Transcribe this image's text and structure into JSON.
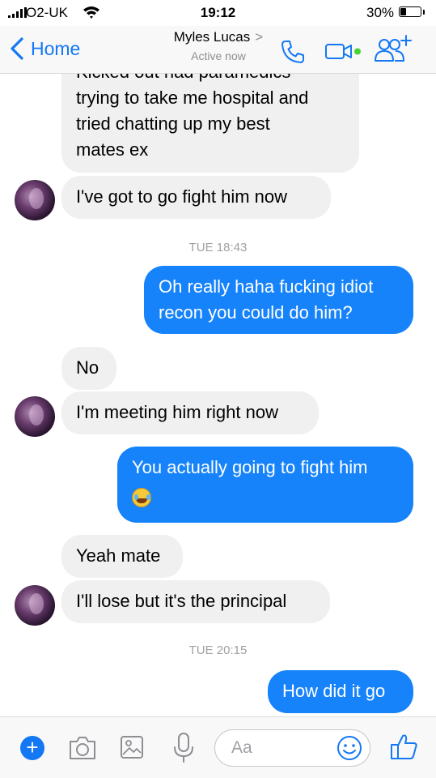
{
  "status_bar": {
    "carrier": "O2-UK",
    "time": "19:12",
    "battery_percent": "30%",
    "battery_level": 0.3
  },
  "header": {
    "back_label": "Home",
    "contact_name": "Myles Lucas",
    "contact_chevron": ">",
    "contact_status": "Active now",
    "icons": [
      "phone-icon",
      "video-call-icon",
      "add-people-icon"
    ]
  },
  "messages": [
    {
      "side": "in",
      "lines": [
        "Kicked out had paramedics",
        "trying to take me hospital and",
        "tried chatting up my best",
        "mates ex"
      ]
    },
    {
      "side": "in",
      "lines": [
        "I've got to go fight him now"
      ]
    },
    {
      "type": "timestamp",
      "text": "TUE 18:43"
    },
    {
      "side": "out",
      "lines": [
        "Oh really haha fucking idiot",
        "recon you could do him?"
      ]
    },
    {
      "side": "in",
      "lines": [
        "No"
      ]
    },
    {
      "side": "in",
      "lines": [
        "I'm meeting him right now"
      ]
    },
    {
      "side": "out",
      "lines": [
        "You actually going to fight him"
      ],
      "emoji": "laughing-crying-emoji"
    },
    {
      "side": "in",
      "lines": [
        "Yeah mate"
      ]
    },
    {
      "side": "in",
      "lines": [
        "I'll lose but it's the principal"
      ]
    },
    {
      "type": "timestamp",
      "text": "TUE 20:15"
    },
    {
      "side": "out",
      "lines": [
        "How did it go"
      ]
    }
  ],
  "composer": {
    "plus_label": "+",
    "placeholder": "Aa",
    "icons": [
      "plus-icon",
      "camera-icon",
      "gallery-icon",
      "microphone-icon",
      "emoji-icon",
      "thumbs-up-icon"
    ]
  },
  "colors": {
    "accent": "#1478f5",
    "outgoing_bubble": "#1783fb",
    "incoming_bubble": "#f1f0f0",
    "header_bg": "#f8f8f8",
    "muted_text": "#8e8e93"
  }
}
